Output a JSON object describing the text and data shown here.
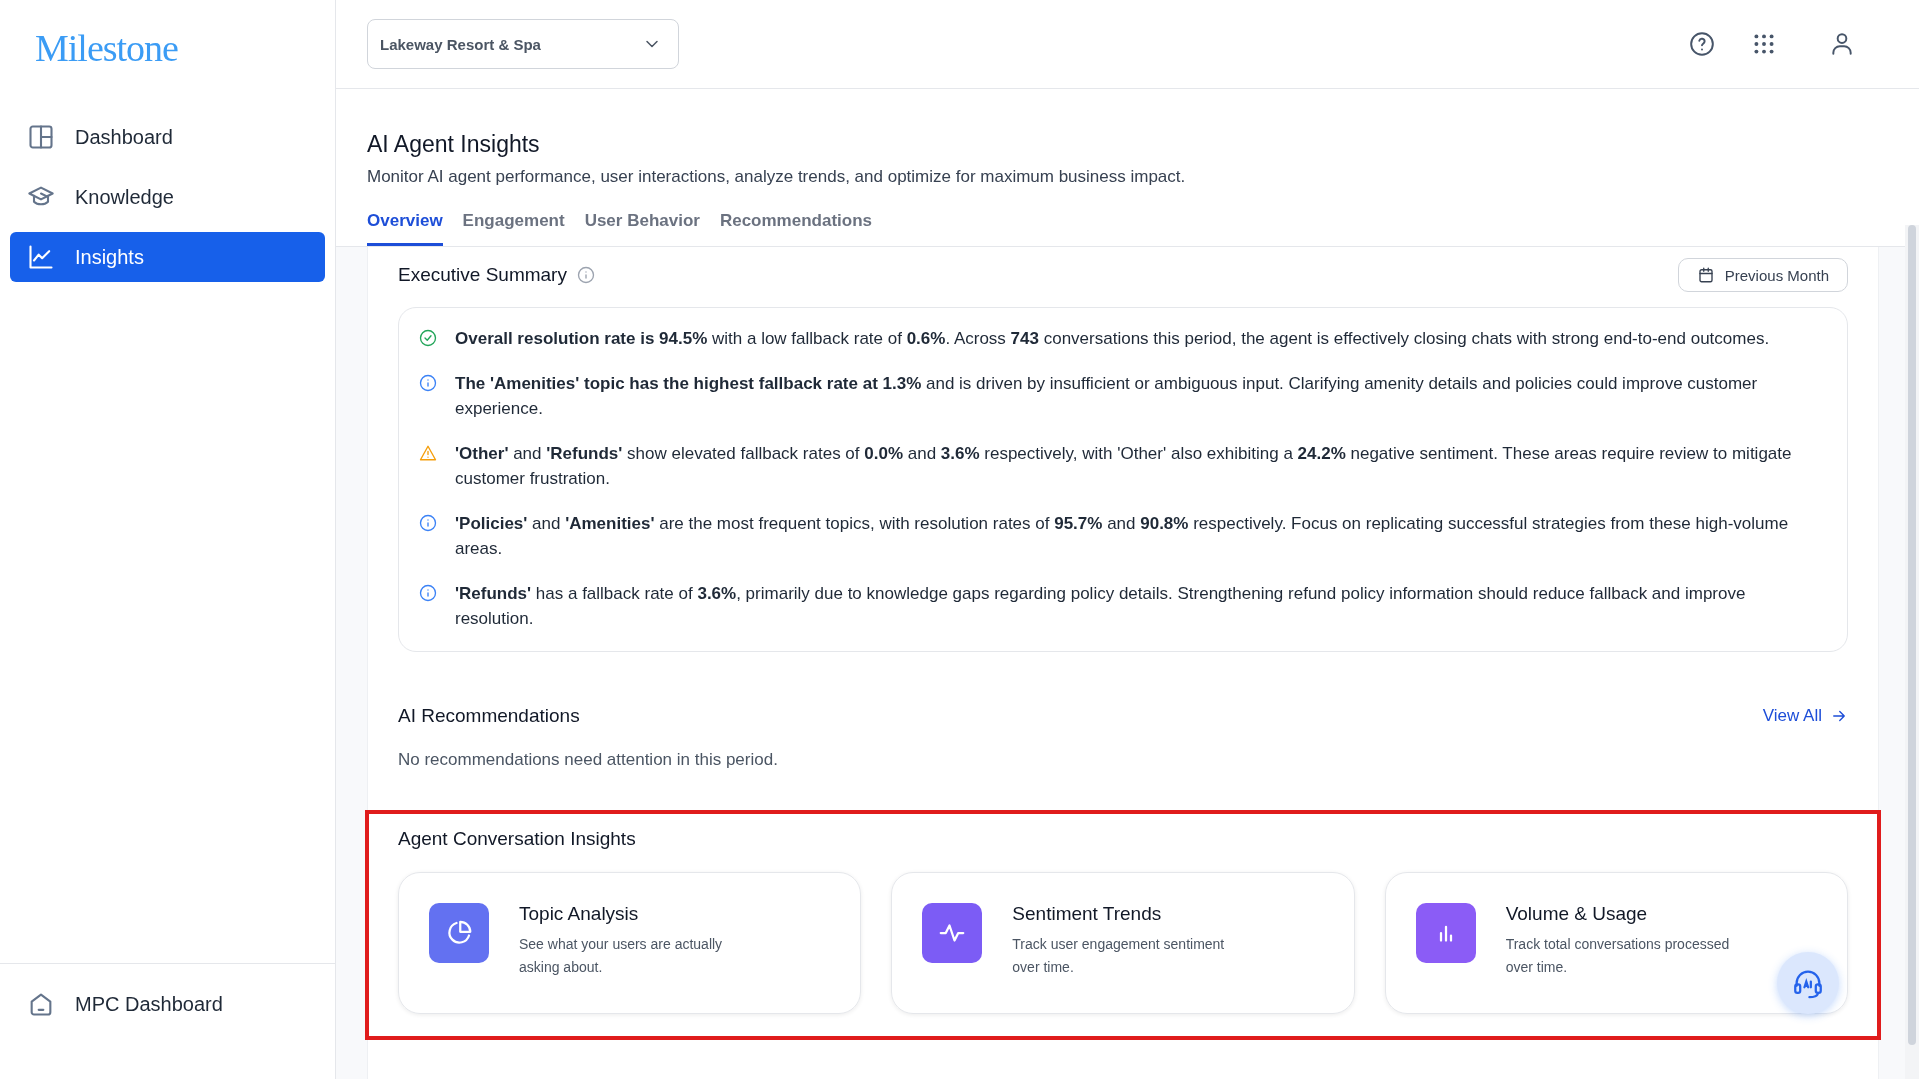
{
  "sidebar": {
    "logo": "Milestone",
    "items": [
      {
        "label": "Dashboard",
        "selected": false
      },
      {
        "label": "Knowledge",
        "selected": false
      },
      {
        "label": "Insights",
        "selected": true
      }
    ],
    "footer_item": {
      "label": "MPC Dashboard"
    }
  },
  "header": {
    "property_select": {
      "value": "Lakeway Resort & Spa"
    }
  },
  "page": {
    "title": "AI Agent Insights",
    "subtitle": "Monitor AI agent performance, user interactions, analyze trends, and optimize for maximum business impact.",
    "tabs": [
      {
        "label": "Overview",
        "selected": true
      },
      {
        "label": "Engagement",
        "selected": false
      },
      {
        "label": "User Behavior",
        "selected": false
      },
      {
        "label": "Recommendations",
        "selected": false
      }
    ]
  },
  "executive_summary": {
    "title": "Executive Summary",
    "period_button": "Previous Month",
    "items": [
      {
        "kind": "success",
        "text": "**Overall resolution rate is 94.5%** with a low fallback rate of **0.6%**. Across **743** conversations this period, the agent is effectively closing chats with strong end-to-end outcomes."
      },
      {
        "kind": "info",
        "text": "**The 'Amenities' topic has the highest fallback rate at 1.3%** and is driven by insufficient or ambiguous input. Clarifying amenity details and policies could improve customer experience."
      },
      {
        "kind": "warning",
        "text": "**'Other'** and **'Refunds'** show elevated fallback rates of **0.0%** and **3.6%** respectively, with 'Other' also exhibiting a **24.2%** negative sentiment. These areas require review to mitigate customer frustration."
      },
      {
        "kind": "info",
        "text": "**'Policies'** and **'Amenities'** are the most frequent topics, with resolution rates of **95.7%** and **90.8%** respectively. Focus on replicating successful strategies from these high-volume areas."
      },
      {
        "kind": "info",
        "text": "**'Refunds'** has a fallback rate of **3.6%**, primarily due to knowledge gaps regarding policy details. Strengthening refund policy information should reduce fallback and improve resolution."
      }
    ]
  },
  "ai_recommendations": {
    "title": "AI Recommendations",
    "link": "View All",
    "empty_text": "No recommendations need attention in this period."
  },
  "conversation_insights": {
    "title": "Agent Conversation Insights",
    "cards": [
      {
        "color": "#6371f1",
        "title": "Topic Analysis",
        "description": "See what your users are actually asking about."
      },
      {
        "color": "#7c5cf5",
        "title": "Sentiment Trends",
        "description": "Track user engagement sentiment over time."
      },
      {
        "color": "#8b5cf6",
        "title": "Volume & Usage",
        "description": "Track total conversations processed over time."
      }
    ]
  }
}
